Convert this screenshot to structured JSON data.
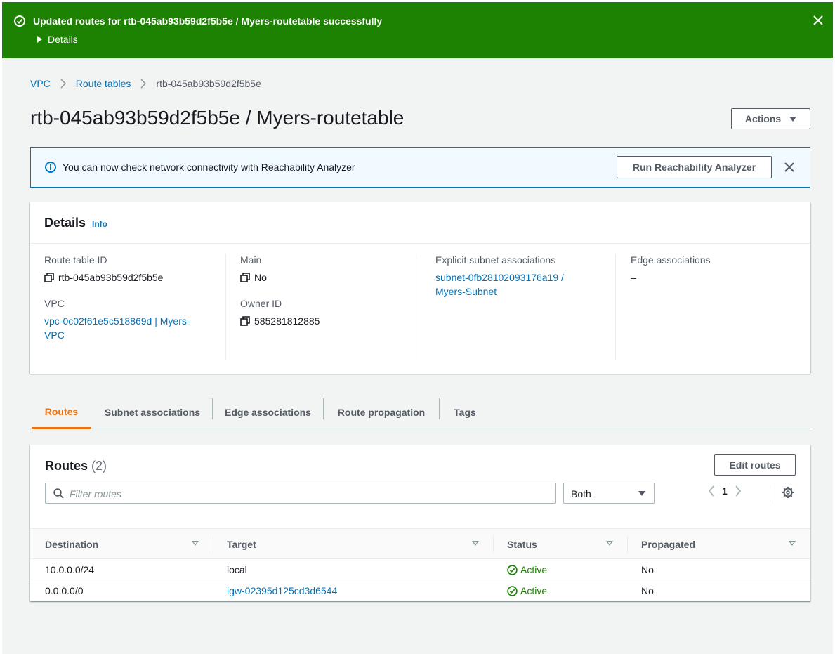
{
  "flash": {
    "message": "Updated routes for rtb-045ab93b59d2f5b5e / Myers-routetable successfully",
    "details_label": "Details"
  },
  "breadcrumb": [
    "VPC",
    "Route tables",
    "rtb-045ab93b59d2f5b5e"
  ],
  "page_title": "rtb-045ab93b59d2f5b5e / Myers-routetable",
  "actions_label": "Actions",
  "info_alert": {
    "message": "You can now check network connectivity with Reachability Analyzer",
    "button_label": "Run Reachability Analyzer"
  },
  "details": {
    "title": "Details",
    "info_link": "Info",
    "route_table_id_label": "Route table ID",
    "route_table_id": "rtb-045ab93b59d2f5b5e",
    "vpc_label": "VPC",
    "vpc_line1": "vpc-0c02f61e5c518869d | Myers-",
    "vpc_line2": "VPC",
    "main_label": "Main",
    "main_value": "No",
    "owner_label": "Owner ID",
    "owner_value": "585281812885",
    "subnet_label": "Explicit subnet associations",
    "subnet_line1": "subnet-0fb28102093176a19 /",
    "subnet_line2": "Myers-Subnet",
    "edge_label": "Edge associations",
    "edge_value": "–"
  },
  "tabs": [
    "Routes",
    "Subnet associations",
    "Edge associations",
    "Route propagation",
    "Tags"
  ],
  "routes": {
    "title": "Routes",
    "count": "(2)",
    "edit_label": "Edit routes",
    "filter_placeholder": "Filter routes",
    "select_value": "Both",
    "page": "1",
    "columns": [
      "Destination",
      "Target",
      "Status",
      "Propagated"
    ],
    "rows": [
      {
        "destination": "10.0.0.0/24",
        "target": "local",
        "status": "Active",
        "propagated": "No"
      },
      {
        "destination": "0.0.0.0/0",
        "target": "igw-02395d125cd3d6544",
        "status": "Active",
        "propagated": "No"
      }
    ]
  },
  "colors": {
    "success": "#1d8102",
    "link": "#0073bb",
    "active_tab": "#ec7211",
    "info_bg": "#f1faff"
  }
}
